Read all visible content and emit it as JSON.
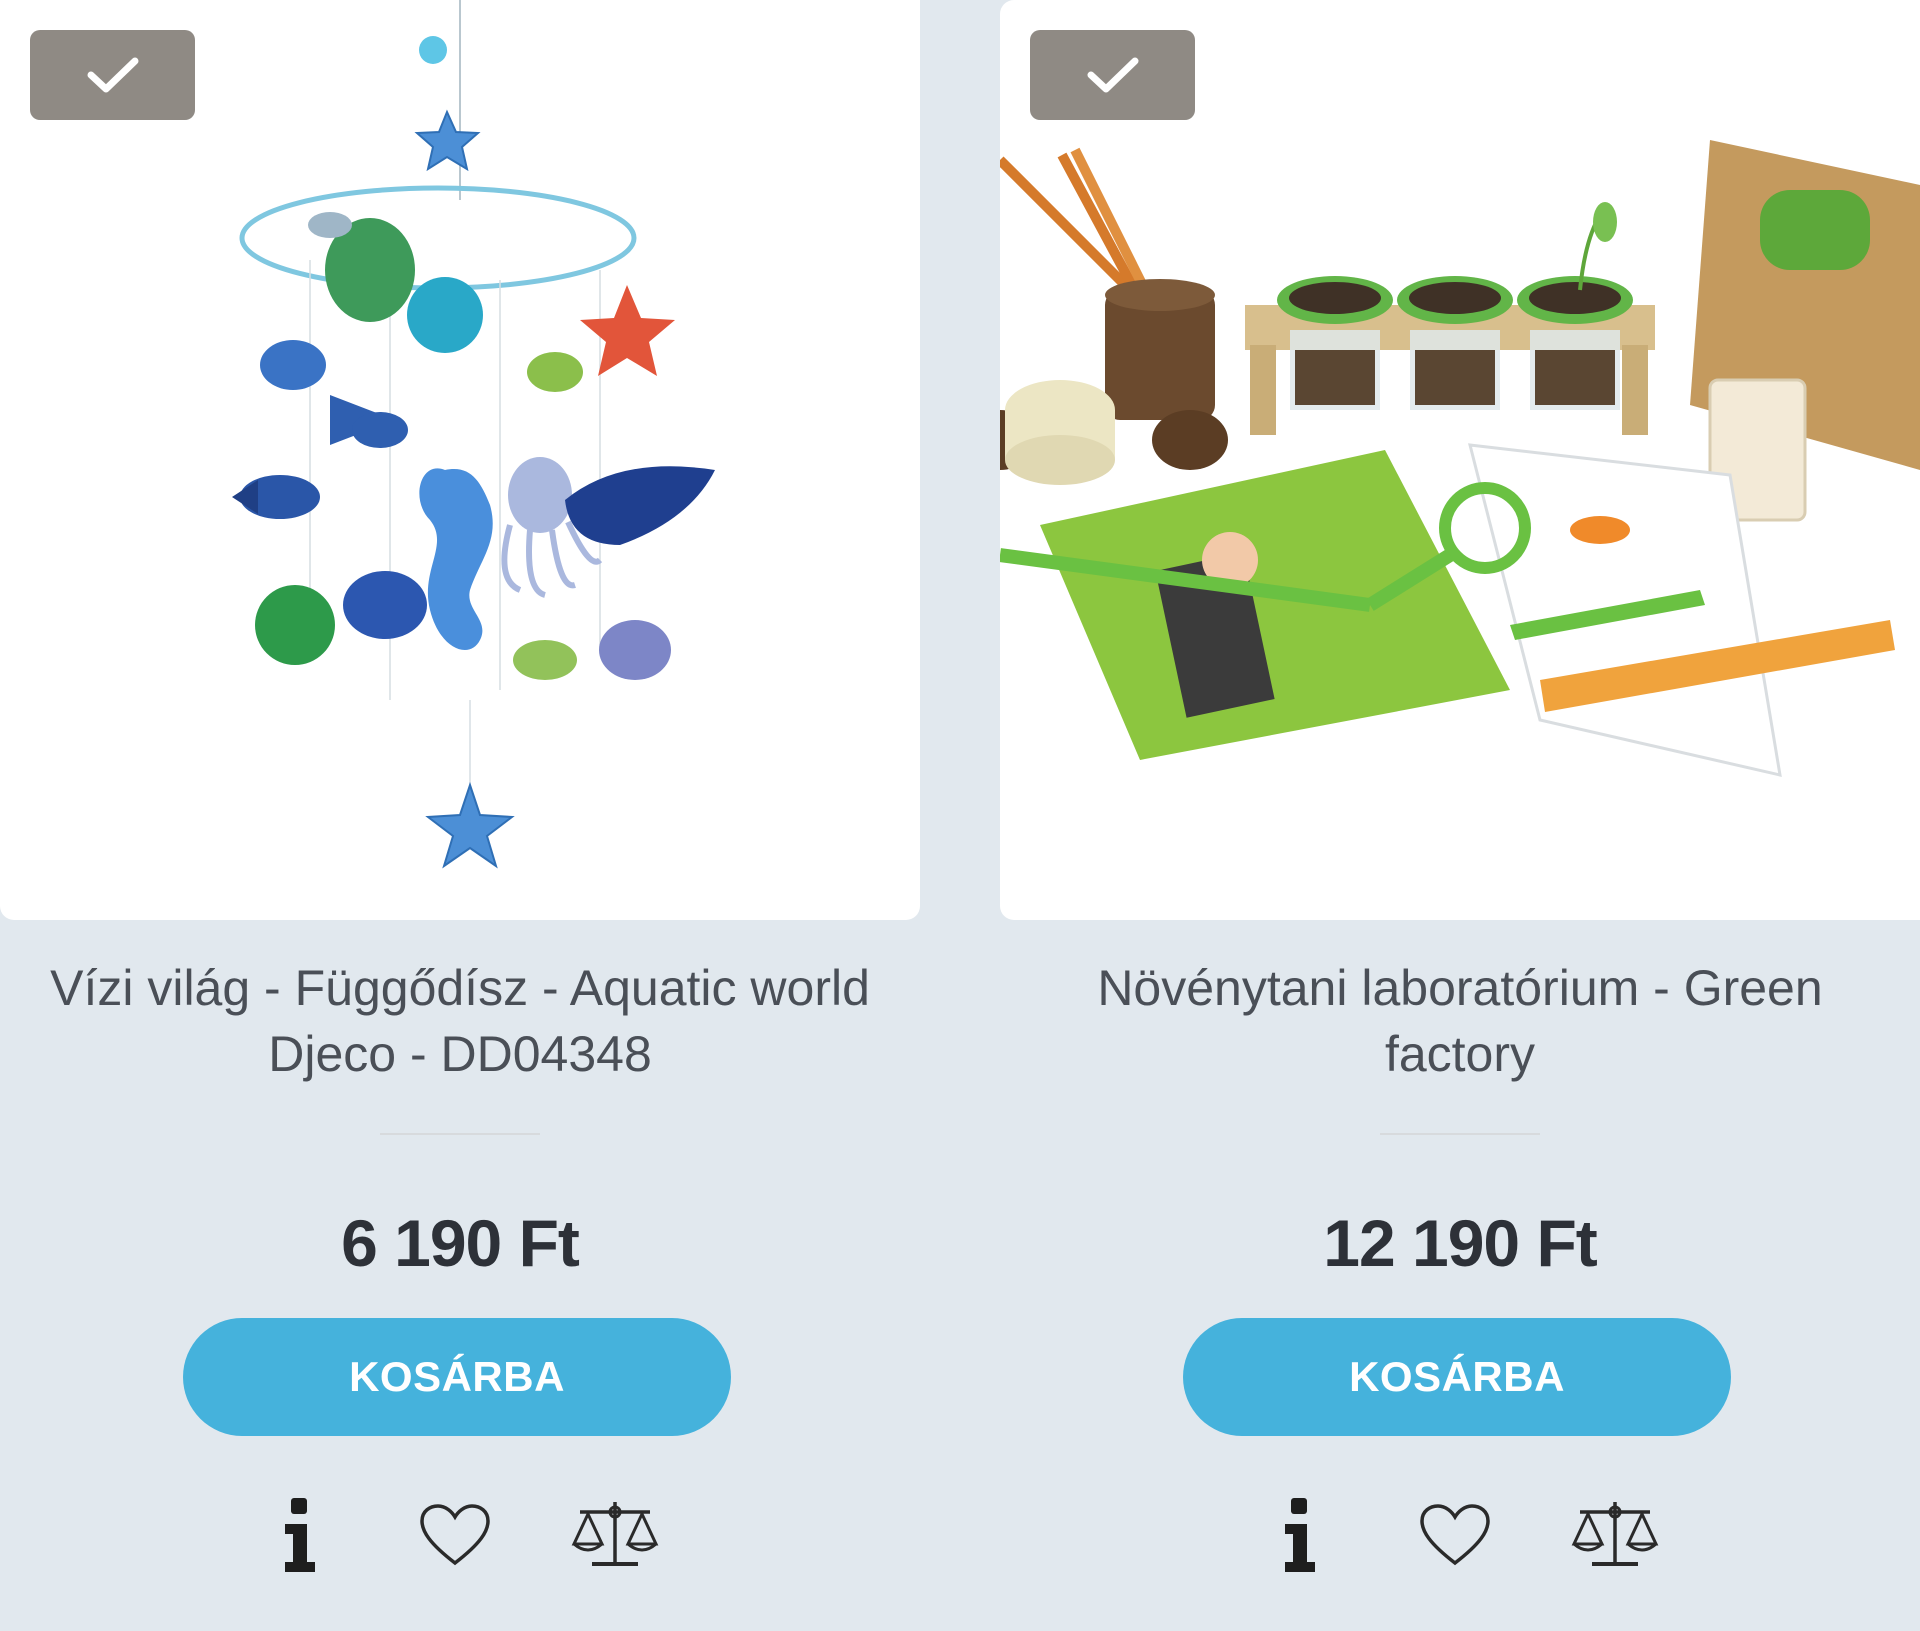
{
  "products": [
    {
      "title": "Vízi világ - Függődísz - Aquatic world Djeco - DD04348",
      "price": "6 190 Ft",
      "cart_label": "KOSÁRBA",
      "image_alt": "Aquatic world hanging mobile",
      "selected": true
    },
    {
      "title": "Növénytani laboratórium - Green factory",
      "price": "12 190 Ft",
      "cart_label": "KOSÁRBA",
      "image_alt": "Green factory botany lab kit",
      "selected": true
    }
  ],
  "icons": {
    "check": "check-icon",
    "info": "info-icon",
    "wishlist": "heart-icon",
    "compare": "scale-icon"
  },
  "colors": {
    "background": "#e1e8ee",
    "cart_button": "#45b2dc",
    "badge": "#8f8a84",
    "price_text": "#2d3138",
    "title_text": "#4a4f57"
  }
}
